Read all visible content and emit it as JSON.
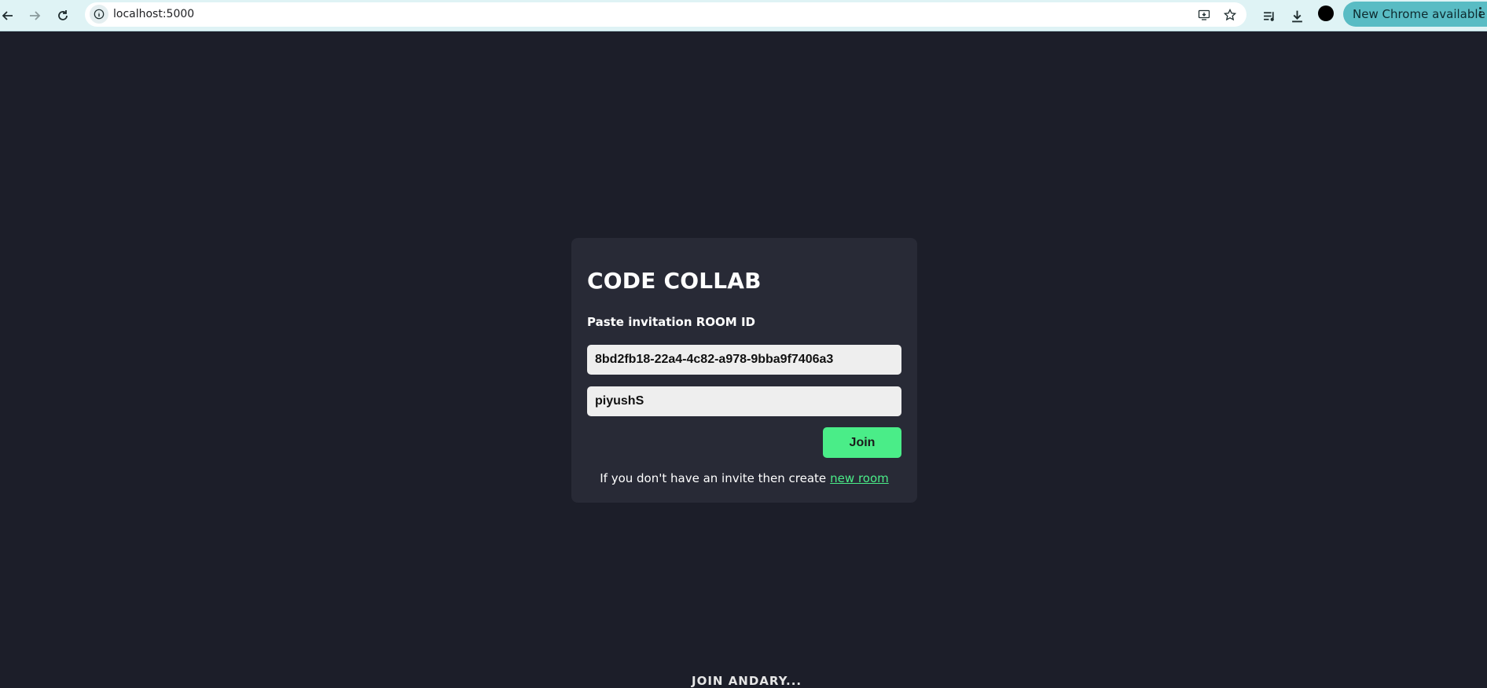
{
  "browser": {
    "url": "localhost:5000",
    "update_label": "New Chrome available",
    "icons": {
      "back": "arrow-left-icon",
      "forward": "arrow-right-icon",
      "reload": "reload-icon",
      "site_info": "info-icon",
      "install": "install-app-icon",
      "bookmark": "star-icon",
      "media": "media-controls-icon",
      "downloads": "download-icon",
      "profile": "profile-avatar",
      "menu": "kebab-menu-icon"
    },
    "colors": {
      "toolbar": "#dff3f5",
      "update_pill": "#59bcc4"
    }
  },
  "page": {
    "title": "CODE COLLAB",
    "subtitle": "Paste invitation ROOM ID",
    "room_id_value": "8bd2fb18-22a4-4c82-a978-9bba9f7406a3",
    "username_value": "piyushS",
    "join_label": "Join",
    "invite_text": "If you don't have an invite then create",
    "new_room_label": "new room",
    "footer_text": "JOIN ANDARY...",
    "colors": {
      "background": "#1c1e29",
      "card": "#282a36",
      "accent": "#4aed88"
    }
  }
}
